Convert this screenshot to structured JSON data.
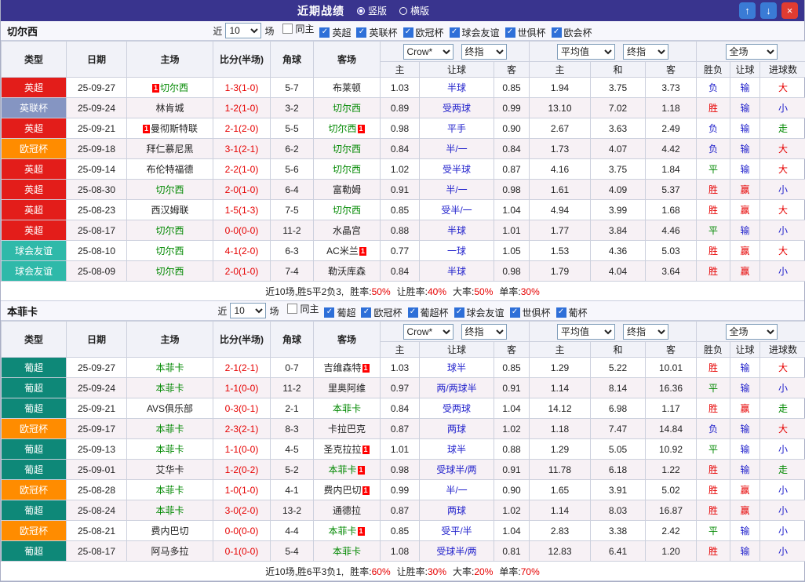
{
  "titlebar": {
    "title": "近期战绩",
    "radios": [
      {
        "label": "竖版",
        "selected": true
      },
      {
        "label": "横版",
        "selected": false
      }
    ],
    "buttons": {
      "up": "↑",
      "down": "↓",
      "close": "×"
    }
  },
  "head": {
    "near": "近",
    "count": "10",
    "games": "场",
    "cols": {
      "type": "类型",
      "date": "日期",
      "home": "主场",
      "score": "比分(半场)",
      "corner": "角球",
      "away": "客场",
      "h": "主",
      "handicap": "让球",
      "a": "客",
      "avg_h": "主",
      "avg_d": "和",
      "avg_a": "客",
      "wdl": "胜负",
      "hresult": "让球",
      "goals": "进球数"
    },
    "dropdowns": {
      "source": "Crow*",
      "time1": "终指",
      "avg": "平均值",
      "time2": "终指",
      "scope": "全场"
    }
  },
  "colors": {
    "titlebar_bg": "#39348e",
    "accent_blue": "#3a7bd5",
    "close_red": "#e03c31",
    "focal_team": "#008800",
    "score": "#e60000",
    "handicap": "#2222cc",
    "leagues": {
      "英超": "#e31d1a",
      "英联杯": "#8595c2",
      "欧冠杯": "#ff8c00",
      "球会友谊": "#2fb9a9",
      "葡超": "#0e8878"
    },
    "results": {
      "胜": "#e60000",
      "平": "#008800",
      "负": "#2222cc",
      "赢": "#e60000",
      "输": "#2222cc",
      "大": "#e60000",
      "小": "#2222cc",
      "走": "#008800"
    }
  },
  "sections": [
    {
      "team": "切尔西",
      "filter": {
        "checks": [
          {
            "label": "同主",
            "checked": false
          },
          {
            "label": "英超",
            "checked": true
          },
          {
            "label": "英联杯",
            "checked": true
          },
          {
            "label": "欧冠杯",
            "checked": true
          },
          {
            "label": "球会友谊",
            "checked": true
          },
          {
            "label": "世俱杯",
            "checked": true
          },
          {
            "label": "欧会杯",
            "checked": true
          }
        ]
      },
      "rows": [
        {
          "league": "英超",
          "date": "25-09-27",
          "home": "切尔西",
          "home_focal": true,
          "home_card": "1",
          "score": "1-3(1-0)",
          "corner": "5-7",
          "away": "布莱顿",
          "away_focal": false,
          "away_card": "",
          "odds": [
            "1.03",
            "半球",
            "0.85"
          ],
          "avg": [
            "1.94",
            "3.75",
            "3.73"
          ],
          "res": [
            "负",
            "输",
            "大"
          ]
        },
        {
          "league": "英联杯",
          "date": "25-09-24",
          "home": "林肯城",
          "home_focal": false,
          "home_card": "",
          "score": "1-2(1-0)",
          "corner": "3-2",
          "away": "切尔西",
          "away_focal": true,
          "away_card": "",
          "odds": [
            "0.89",
            "受两球",
            "0.99"
          ],
          "avg": [
            "13.10",
            "7.02",
            "1.18"
          ],
          "res": [
            "胜",
            "输",
            "小"
          ]
        },
        {
          "league": "英超",
          "date": "25-09-21",
          "home": "曼彻斯特联",
          "home_focal": false,
          "home_card": "1",
          "score": "2-1(2-0)",
          "corner": "5-5",
          "away": "切尔西",
          "away_focal": true,
          "away_card": "1",
          "odds": [
            "0.98",
            "平手",
            "0.90"
          ],
          "avg": [
            "2.67",
            "3.63",
            "2.49"
          ],
          "res": [
            "负",
            "输",
            "走"
          ]
        },
        {
          "league": "欧冠杯",
          "date": "25-09-18",
          "home": "拜仁慕尼黑",
          "home_focal": false,
          "home_card": "",
          "score": "3-1(2-1)",
          "corner": "6-2",
          "away": "切尔西",
          "away_focal": true,
          "away_card": "",
          "odds": [
            "0.84",
            "半/一",
            "0.84"
          ],
          "avg": [
            "1.73",
            "4.07",
            "4.42"
          ],
          "res": [
            "负",
            "输",
            "大"
          ]
        },
        {
          "league": "英超",
          "date": "25-09-14",
          "home": "布伦特福德",
          "home_focal": false,
          "home_card": "",
          "score": "2-2(1-0)",
          "corner": "5-6",
          "away": "切尔西",
          "away_focal": true,
          "away_card": "",
          "odds": [
            "1.02",
            "受半球",
            "0.87"
          ],
          "avg": [
            "4.16",
            "3.75",
            "1.84"
          ],
          "res": [
            "平",
            "输",
            "大"
          ]
        },
        {
          "league": "英超",
          "date": "25-08-30",
          "home": "切尔西",
          "home_focal": true,
          "home_card": "",
          "score": "2-0(1-0)",
          "corner": "6-4",
          "away": "富勒姆",
          "away_focal": false,
          "away_card": "",
          "odds": [
            "0.91",
            "半/一",
            "0.98"
          ],
          "avg": [
            "1.61",
            "4.09",
            "5.37"
          ],
          "res": [
            "胜",
            "赢",
            "小"
          ]
        },
        {
          "league": "英超",
          "date": "25-08-23",
          "home": "西汉姆联",
          "home_focal": false,
          "home_card": "",
          "score": "1-5(1-3)",
          "corner": "7-5",
          "away": "切尔西",
          "away_focal": true,
          "away_card": "",
          "odds": [
            "0.85",
            "受半/一",
            "1.04"
          ],
          "avg": [
            "4.94",
            "3.99",
            "1.68"
          ],
          "res": [
            "胜",
            "赢",
            "大"
          ]
        },
        {
          "league": "英超",
          "date": "25-08-17",
          "home": "切尔西",
          "home_focal": true,
          "home_card": "",
          "score": "0-0(0-0)",
          "corner": "11-2",
          "away": "水晶宫",
          "away_focal": false,
          "away_card": "",
          "odds": [
            "0.88",
            "半球",
            "1.01"
          ],
          "avg": [
            "1.77",
            "3.84",
            "4.46"
          ],
          "res": [
            "平",
            "输",
            "小"
          ]
        },
        {
          "league": "球会友谊",
          "date": "25-08-10",
          "home": "切尔西",
          "home_focal": true,
          "home_card": "",
          "score": "4-1(2-0)",
          "corner": "6-3",
          "away": "AC米兰",
          "away_focal": false,
          "away_card": "1",
          "odds": [
            "0.77",
            "一球",
            "1.05"
          ],
          "avg": [
            "1.53",
            "4.36",
            "5.03"
          ],
          "res": [
            "胜",
            "赢",
            "大"
          ]
        },
        {
          "league": "球会友谊",
          "date": "25-08-09",
          "home": "切尔西",
          "home_focal": true,
          "home_card": "",
          "score": "2-0(1-0)",
          "corner": "7-4",
          "away": "勒沃库森",
          "away_focal": false,
          "away_card": "",
          "odds": [
            "0.84",
            "半球",
            "0.98"
          ],
          "avg": [
            "1.79",
            "4.04",
            "3.64"
          ],
          "res": [
            "胜",
            "赢",
            "小"
          ]
        }
      ],
      "summary": {
        "prefix": "近10场,胜5平2负3,",
        "stats": [
          {
            "label": "胜率:",
            "value": "50%"
          },
          {
            "label": "让胜率:",
            "value": "40%"
          },
          {
            "label": "大率:",
            "value": "50%"
          },
          {
            "label": "单率:",
            "value": "30%"
          }
        ]
      }
    },
    {
      "team": "本菲卡",
      "filter": {
        "checks": [
          {
            "label": "同主",
            "checked": false
          },
          {
            "label": "葡超",
            "checked": true
          },
          {
            "label": "欧冠杯",
            "checked": true
          },
          {
            "label": "葡超杯",
            "checked": true
          },
          {
            "label": "球会友谊",
            "checked": true
          },
          {
            "label": "世俱杯",
            "checked": true
          },
          {
            "label": "葡杯",
            "checked": true
          }
        ]
      },
      "rows": [
        {
          "league": "葡超",
          "date": "25-09-27",
          "home": "本菲卡",
          "home_focal": true,
          "home_card": "",
          "score": "2-1(2-1)",
          "corner": "0-7",
          "away": "吉维森特",
          "away_focal": false,
          "away_card": "1",
          "odds": [
            "1.03",
            "球半",
            "0.85"
          ],
          "avg": [
            "1.29",
            "5.22",
            "10.01"
          ],
          "res": [
            "胜",
            "输",
            "大"
          ]
        },
        {
          "league": "葡超",
          "date": "25-09-24",
          "home": "本菲卡",
          "home_focal": true,
          "home_card": "",
          "score": "1-1(0-0)",
          "corner": "11-2",
          "away": "里奥阿维",
          "away_focal": false,
          "away_card": "",
          "odds": [
            "0.97",
            "两/两球半",
            "0.91"
          ],
          "avg": [
            "1.14",
            "8.14",
            "16.36"
          ],
          "res": [
            "平",
            "输",
            "小"
          ]
        },
        {
          "league": "葡超",
          "date": "25-09-21",
          "home": "AVS俱乐部",
          "home_focal": false,
          "home_card": "",
          "score": "0-3(0-1)",
          "corner": "2-1",
          "away": "本菲卡",
          "away_focal": true,
          "away_card": "",
          "odds": [
            "0.84",
            "受两球",
            "1.04"
          ],
          "avg": [
            "14.12",
            "6.98",
            "1.17"
          ],
          "res": [
            "胜",
            "赢",
            "走"
          ]
        },
        {
          "league": "欧冠杯",
          "date": "25-09-17",
          "home": "本菲卡",
          "home_focal": true,
          "home_card": "",
          "score": "2-3(2-1)",
          "corner": "8-3",
          "away": "卡拉巴克",
          "away_focal": false,
          "away_card": "",
          "odds": [
            "0.87",
            "两球",
            "1.02"
          ],
          "avg": [
            "1.18",
            "7.47",
            "14.84"
          ],
          "res": [
            "负",
            "输",
            "大"
          ]
        },
        {
          "league": "葡超",
          "date": "25-09-13",
          "home": "本菲卡",
          "home_focal": true,
          "home_card": "",
          "score": "1-1(0-0)",
          "corner": "4-5",
          "away": "圣克拉拉",
          "away_focal": false,
          "away_card": "1",
          "odds": [
            "1.01",
            "球半",
            "0.88"
          ],
          "avg": [
            "1.29",
            "5.05",
            "10.92"
          ],
          "res": [
            "平",
            "输",
            "小"
          ]
        },
        {
          "league": "葡超",
          "date": "25-09-01",
          "home": "艾华卡",
          "home_focal": false,
          "home_card": "",
          "score": "1-2(0-2)",
          "corner": "5-2",
          "away": "本菲卡",
          "away_focal": true,
          "away_card": "1",
          "odds": [
            "0.98",
            "受球半/两",
            "0.91"
          ],
          "avg": [
            "11.78",
            "6.18",
            "1.22"
          ],
          "res": [
            "胜",
            "输",
            "走"
          ]
        },
        {
          "league": "欧冠杯",
          "date": "25-08-28",
          "home": "本菲卡",
          "home_focal": true,
          "home_card": "",
          "score": "1-0(1-0)",
          "corner": "4-1",
          "away": "费内巴切",
          "away_focal": false,
          "away_card": "1",
          "odds": [
            "0.99",
            "半/一",
            "0.90"
          ],
          "avg": [
            "1.65",
            "3.91",
            "5.02"
          ],
          "res": [
            "胜",
            "赢",
            "小"
          ]
        },
        {
          "league": "葡超",
          "date": "25-08-24",
          "home": "本菲卡",
          "home_focal": true,
          "home_card": "",
          "score": "3-0(2-0)",
          "corner": "13-2",
          "away": "通德拉",
          "away_focal": false,
          "away_card": "",
          "odds": [
            "0.87",
            "两球",
            "1.02"
          ],
          "avg": [
            "1.14",
            "8.03",
            "16.87"
          ],
          "res": [
            "胜",
            "赢",
            "小"
          ]
        },
        {
          "league": "欧冠杯",
          "date": "25-08-21",
          "home": "费内巴切",
          "home_focal": false,
          "home_card": "",
          "score": "0-0(0-0)",
          "corner": "4-4",
          "away": "本菲卡",
          "away_focal": true,
          "away_card": "1",
          "odds": [
            "0.85",
            "受平/半",
            "1.04"
          ],
          "avg": [
            "2.83",
            "3.38",
            "2.42"
          ],
          "res": [
            "平",
            "输",
            "小"
          ]
        },
        {
          "league": "葡超",
          "date": "25-08-17",
          "home": "阿马多拉",
          "home_focal": false,
          "home_card": "",
          "score": "0-1(0-0)",
          "corner": "5-4",
          "away": "本菲卡",
          "away_focal": true,
          "away_card": "",
          "odds": [
            "1.08",
            "受球半/两",
            "0.81"
          ],
          "avg": [
            "12.83",
            "6.41",
            "1.20"
          ],
          "res": [
            "胜",
            "输",
            "小"
          ]
        }
      ],
      "summary": {
        "prefix": "近10场,胜6平3负1,",
        "stats": [
          {
            "label": "胜率:",
            "value": "60%"
          },
          {
            "label": "让胜率:",
            "value": "30%"
          },
          {
            "label": "大率:",
            "value": "20%"
          },
          {
            "label": "单率:",
            "value": "70%"
          }
        ]
      }
    }
  ]
}
